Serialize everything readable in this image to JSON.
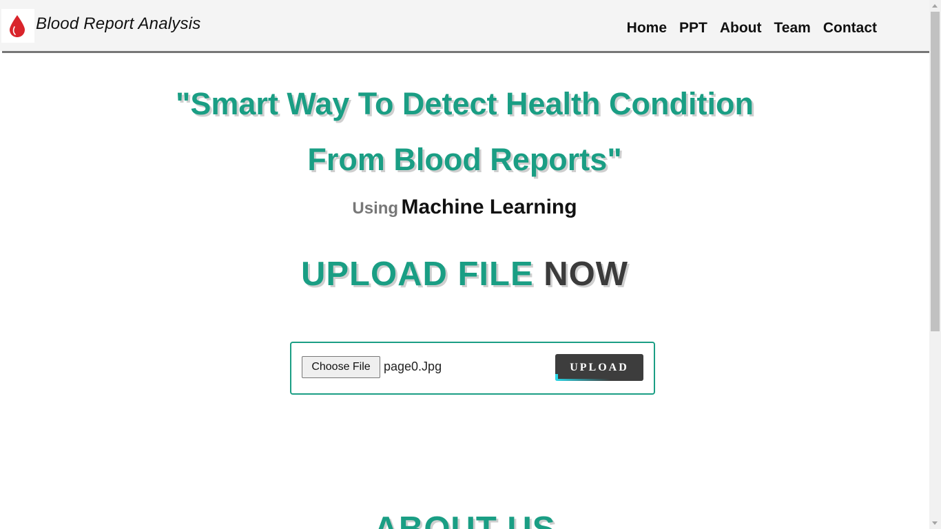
{
  "header": {
    "brand": "Blood Report Analysis",
    "nav": [
      "Home",
      "PPT",
      "About",
      "Team",
      "Contact"
    ]
  },
  "hero": {
    "tagline_line1": "\"Smart Way To Detect Health Condition",
    "tagline_line2": "From Blood Reports\"",
    "using_prefix": "Using",
    "using_highlight": "Machine Learning",
    "upload_heading_accent": "UPLOAD FILE",
    "upload_heading_dark": "NOW"
  },
  "upload_form": {
    "choose_file_label": "Choose File",
    "file_name": "page0.Jpg",
    "upload_label": "UPLOAD"
  },
  "about": {
    "heading": "ABOUT US"
  },
  "colors": {
    "accent": "#1a9e84",
    "dark": "#3b3b3b",
    "logo_red": "#d9242b",
    "upload_bar": "#2ad6e6"
  },
  "icons": {
    "logo": "blood-drop-icon"
  }
}
